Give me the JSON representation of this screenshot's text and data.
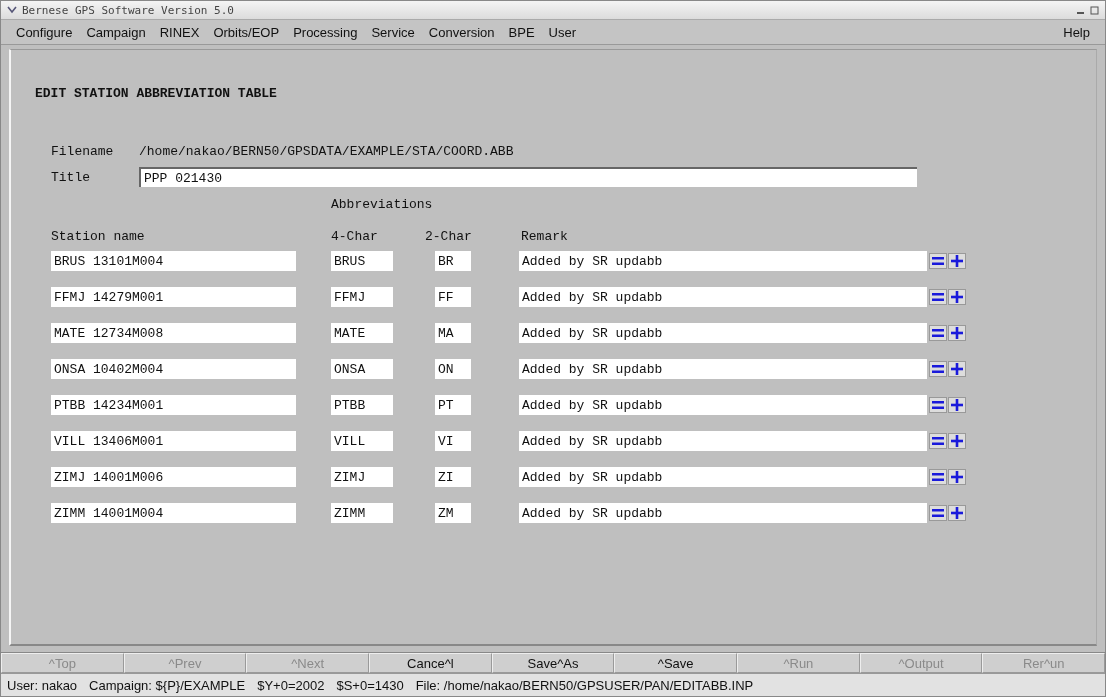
{
  "window": {
    "title": "Bernese GPS Software Version 5.0"
  },
  "menu": [
    {
      "label": "Configure"
    },
    {
      "label": "Campaign"
    },
    {
      "label": "RINEX"
    },
    {
      "label": "Orbits/EOP"
    },
    {
      "label": "Processing"
    },
    {
      "label": "Service"
    },
    {
      "label": "Conversion"
    },
    {
      "label": "BPE"
    },
    {
      "label": "User"
    },
    {
      "label": "Help"
    }
  ],
  "panel": {
    "heading": "EDIT STATION ABBREVIATION TABLE",
    "filename_label": "Filename",
    "filename": "/home/nakao/BERN50/GPSDATA/EXAMPLE/STA/COORD.ABB",
    "title_label": "Title",
    "title_value": "PPP 021430",
    "group_header": "Abbreviations",
    "columns": [
      "Station name",
      "4-Char",
      "2-Char",
      "Remark"
    ],
    "rows": [
      {
        "station": "BRUS 13101M004",
        "abbr4": "BRUS",
        "abbr2": "BR",
        "remark": "Added by SR updabb"
      },
      {
        "station": "FFMJ 14279M001",
        "abbr4": "FFMJ",
        "abbr2": "FF",
        "remark": "Added by SR updabb"
      },
      {
        "station": "MATE 12734M008",
        "abbr4": "MATE",
        "abbr2": "MA",
        "remark": "Added by SR updabb"
      },
      {
        "station": "ONSA 10402M004",
        "abbr4": "ONSA",
        "abbr2": "ON",
        "remark": "Added by SR updabb"
      },
      {
        "station": "PTBB 14234M001",
        "abbr4": "PTBB",
        "abbr2": "PT",
        "remark": "Added by SR updabb"
      },
      {
        "station": "VILL 13406M001",
        "abbr4": "VILL",
        "abbr2": "VI",
        "remark": "Added by SR updabb"
      },
      {
        "station": "ZIMJ 14001M006",
        "abbr4": "ZIMJ",
        "abbr2": "ZI",
        "remark": "Added by SR updabb"
      },
      {
        "station": "ZIMM 14001M004",
        "abbr4": "ZIMM",
        "abbr2": "ZM",
        "remark": "Added by SR updabb"
      }
    ]
  },
  "toolbar": [
    {
      "label": "^Top",
      "disabled": true
    },
    {
      "label": "^Prev",
      "disabled": true
    },
    {
      "label": "^Next",
      "disabled": true
    },
    {
      "label": "Cance^l",
      "disabled": false
    },
    {
      "label": "Save^As",
      "disabled": false
    },
    {
      "label": "^Save",
      "disabled": false
    },
    {
      "label": "^Run",
      "disabled": true
    },
    {
      "label": "^Output",
      "disabled": true
    },
    {
      "label": "Rer^un",
      "disabled": true
    }
  ],
  "status_bar": [
    "User: nakao",
    "Campaign: ${P}/EXAMPLE",
    "$Y+0=2002",
    "$S+0=1430",
    "File: /home/nakao/BERN50/GPSUSER/PAN/EDITABB.INP"
  ]
}
